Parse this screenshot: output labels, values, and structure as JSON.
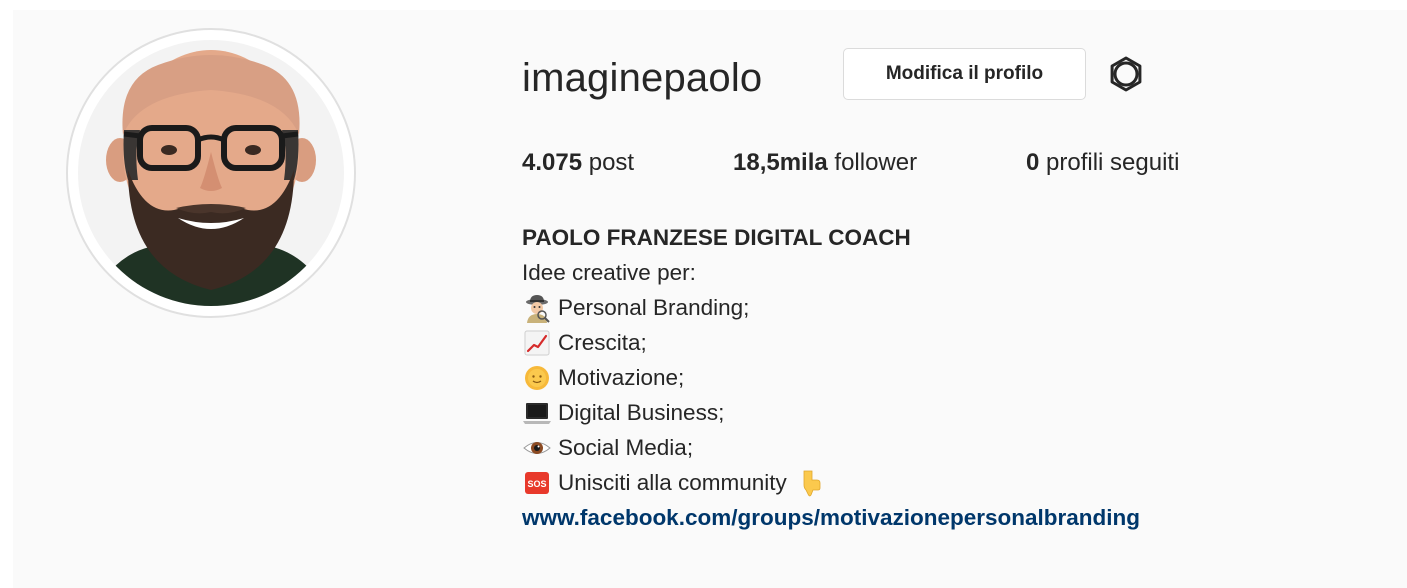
{
  "profile": {
    "username": "imaginepaolo",
    "edit_button_label": "Modifica il profilo",
    "settings_icon": "gear-icon",
    "avatar_icon": "profile-photo"
  },
  "stats": {
    "posts_count": "4.075",
    "posts_label": "post",
    "followers_count": "18,5mila",
    "followers_label": "follower",
    "following_count": "0",
    "following_label": "profili seguiti"
  },
  "bio": {
    "name": "PAOLO FRANZESE DIGITAL COACH",
    "intro": "Idee creative per:",
    "items": [
      {
        "icon": "detective-emoji-icon",
        "text": "Personal Branding;"
      },
      {
        "icon": "chart-increasing-emoji-icon",
        "text": "Crescita;"
      },
      {
        "icon": "sun-face-emoji-icon",
        "text": "Motivazione;"
      },
      {
        "icon": "laptop-emoji-icon",
        "text": "Digital Business;"
      },
      {
        "icon": "eye-emoji-icon",
        "text": "Social Media;"
      },
      {
        "icon": "sos-emoji-icon",
        "text": "Unisciti alla community",
        "trailing_icon": "pointing-down-emoji-icon"
      }
    ],
    "link": "www.facebook.com/groups/motivazionepersonalbranding"
  },
  "colors": {
    "background": "#fafafa",
    "text": "#262626",
    "link": "#00376b",
    "button_border": "#dbdbdb"
  }
}
